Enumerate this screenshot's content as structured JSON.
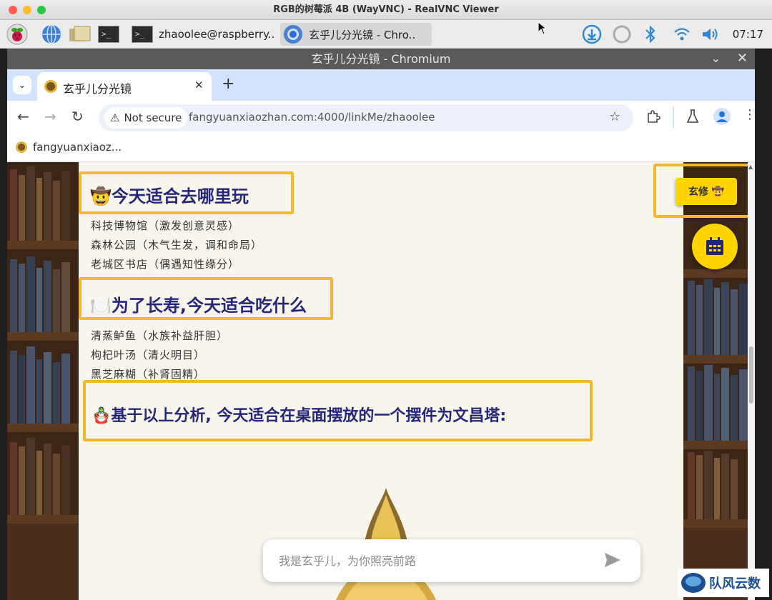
{
  "mac_window": {
    "title": "RGB的树莓派 4B (WayVNC) - RealVNC Viewer"
  },
  "taskbar": {
    "task1": "zhaoolee@raspberry..",
    "task2": "玄乎儿分光镜 - Chro..",
    "clock": "07:17",
    "term_glyph": ">_"
  },
  "browser": {
    "window_title": "玄乎儿分光镜 - Chromium",
    "tab_title": "玄乎儿分光镜",
    "security": "Not secure",
    "url": "fangyuanxiaozhan.com:4000/linkMe/zhaoolee",
    "bookmark": "fangyuanxiaoz..."
  },
  "page": {
    "section1": {
      "icon": "🤠",
      "title": "今天适合去哪里玩",
      "items": [
        "科技博物馆（激发创意灵感）",
        "森林公园（木气生发，调和命局）",
        "老城区书店（偶遇知性缘分）"
      ]
    },
    "section2": {
      "icon": "🍽️",
      "title": "为了长寿,今天适合吃什么",
      "items": [
        "清蒸鲈鱼（水族补益肝胆）",
        "枸杞叶汤（清火明目）",
        "黑芝麻糊（补肾固精）"
      ]
    },
    "section3": {
      "icon": "🪆",
      "title": "基于以上分析, 今天适合在桌面摆放的一个摆件为文昌塔:"
    },
    "xuanxiu_button": "玄修 🤠",
    "chat_placeholder": "我是玄乎儿，为你照亮前路"
  },
  "watermark": "队风云数",
  "colors": {
    "heading": "#27277a",
    "highlight": "#f3b92d",
    "accent": "#ffd400",
    "tab_strip": "#d3e3fd"
  }
}
